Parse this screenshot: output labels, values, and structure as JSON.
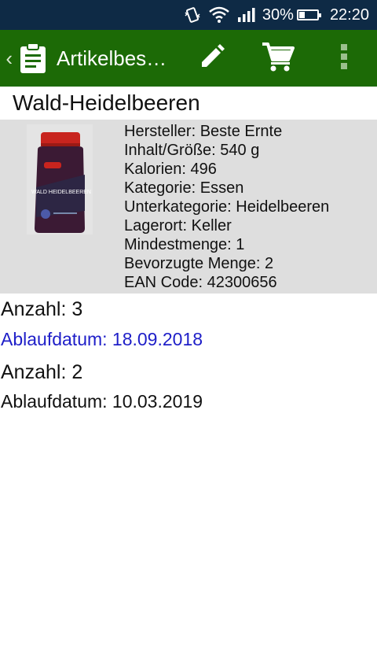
{
  "status_bar": {
    "battery_percent": "30%",
    "battery_level": 0.3,
    "time": "22:20",
    "icons": [
      "vibrate-icon",
      "wifi-icon",
      "signal-icon",
      "battery-icon"
    ]
  },
  "app_bar": {
    "title": "Artikelbes…",
    "icons": [
      "back-chevron-icon",
      "clipboard-icon",
      "pencil-icon",
      "cart-icon",
      "overflow-menu-icon"
    ],
    "background": "#1c6a06"
  },
  "product": {
    "name": "Wald-Heidelbeeren",
    "image_label": "WALD HEIDELBEEREN",
    "attributes": [
      "Hersteller: Beste Ernte",
      "Inhalt/Größe: 540 g",
      "Kalorien: 496",
      "Kategorie: Essen",
      "Unterkategorie: Heidelbeeren",
      "Lagerort: Keller",
      "Mindestmenge: 1",
      "Bevorzugte Menge: 2",
      "EAN Code: 42300656"
    ]
  },
  "stock_items": [
    {
      "count": "Anzahl: 3",
      "expiry": "Ablaufdatum: 18.09.2018",
      "expiry_color": "#1e1ec8"
    },
    {
      "count": "Anzahl: 2",
      "expiry": "Ablaufdatum: 10.03.2019",
      "expiry_color": "#111111"
    }
  ]
}
